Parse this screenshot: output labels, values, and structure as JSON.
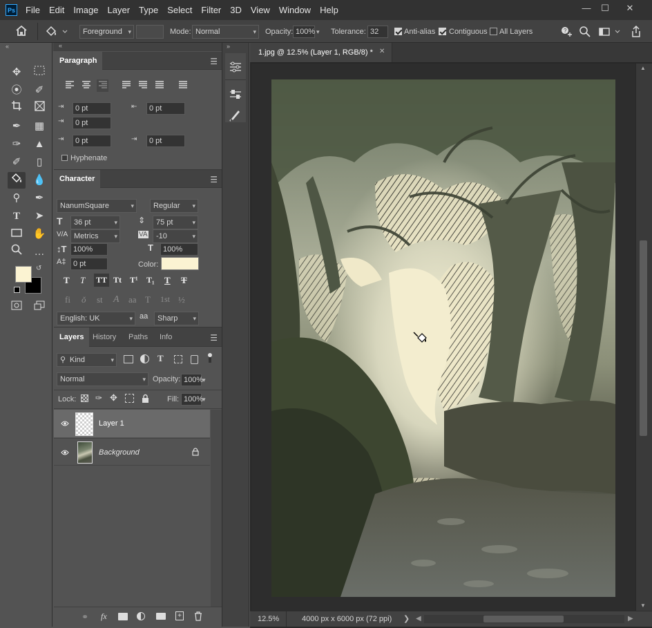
{
  "app": {
    "logo": "Ps"
  },
  "menu": [
    "File",
    "Edit",
    "Image",
    "Layer",
    "Type",
    "Select",
    "Filter",
    "3D",
    "View",
    "Window",
    "Help"
  ],
  "window_controls": {
    "minimize": "—",
    "maximize": "☐",
    "close": "✕"
  },
  "options": {
    "fill_source": "Foreground",
    "mode_label": "Mode:",
    "mode_value": "Normal",
    "opacity_label": "Opacity:",
    "opacity_value": "100%",
    "tolerance_label": "Tolerance:",
    "tolerance_value": "32",
    "anti_alias_label": "Anti-alias",
    "anti_alias_checked": true,
    "contiguous_label": "Contiguous",
    "contiguous_checked": true,
    "all_layers_label": "All Layers",
    "all_layers_checked": false
  },
  "paragraph": {
    "tab": "Paragraph",
    "indent_left": "0 pt",
    "indent_right": "0 pt",
    "indent_first": "0 pt",
    "space_before": "0 pt",
    "space_after": "0 pt",
    "hyphenate_label": "Hyphenate"
  },
  "character": {
    "tab": "Character",
    "font_family": "NanumSquare",
    "font_style": "Regular",
    "font_size": "36 pt",
    "leading": "75 pt",
    "kerning": "Metrics",
    "tracking": "-10",
    "vertical_scale": "100%",
    "horizontal_scale": "100%",
    "baseline_shift": "0 pt",
    "color_label": "Color:",
    "color_swatch": "#fbf3d2",
    "language": "English: UK",
    "aa_icon_text": "aa",
    "antialias": "Sharp",
    "style_buttons": [
      "T",
      "T",
      "TT",
      "Tt",
      "T¹",
      "T₁",
      "T",
      "T"
    ],
    "opentype_buttons": [
      "fi",
      "ǒ",
      "st",
      "A",
      "aa",
      "T",
      "1st",
      "½"
    ]
  },
  "colors": {
    "foreground": "#fbf3d2",
    "background": "#000000",
    "accent": "#31a8ff"
  },
  "layers": {
    "tabs": [
      "Layers",
      "History",
      "Paths",
      "Info"
    ],
    "filter_kind": "Kind",
    "blend_mode": "Normal",
    "opacity_label": "Opacity:",
    "opacity_value": "100%",
    "lock_label": "Lock:",
    "fill_label": "Fill:",
    "fill_value": "100%",
    "items": [
      {
        "name": "Layer 1",
        "selected": true,
        "locked": false
      },
      {
        "name": "Background",
        "selected": false,
        "locked": true
      }
    ]
  },
  "document": {
    "tab_title": "1.jpg @ 12.5% (Layer 1, RGB/8) *",
    "close_glyph": "✕"
  },
  "status": {
    "zoom": "12.5%",
    "dimensions": "4000 px x 6000 px (72 ppi)",
    "arrow": "❯"
  }
}
